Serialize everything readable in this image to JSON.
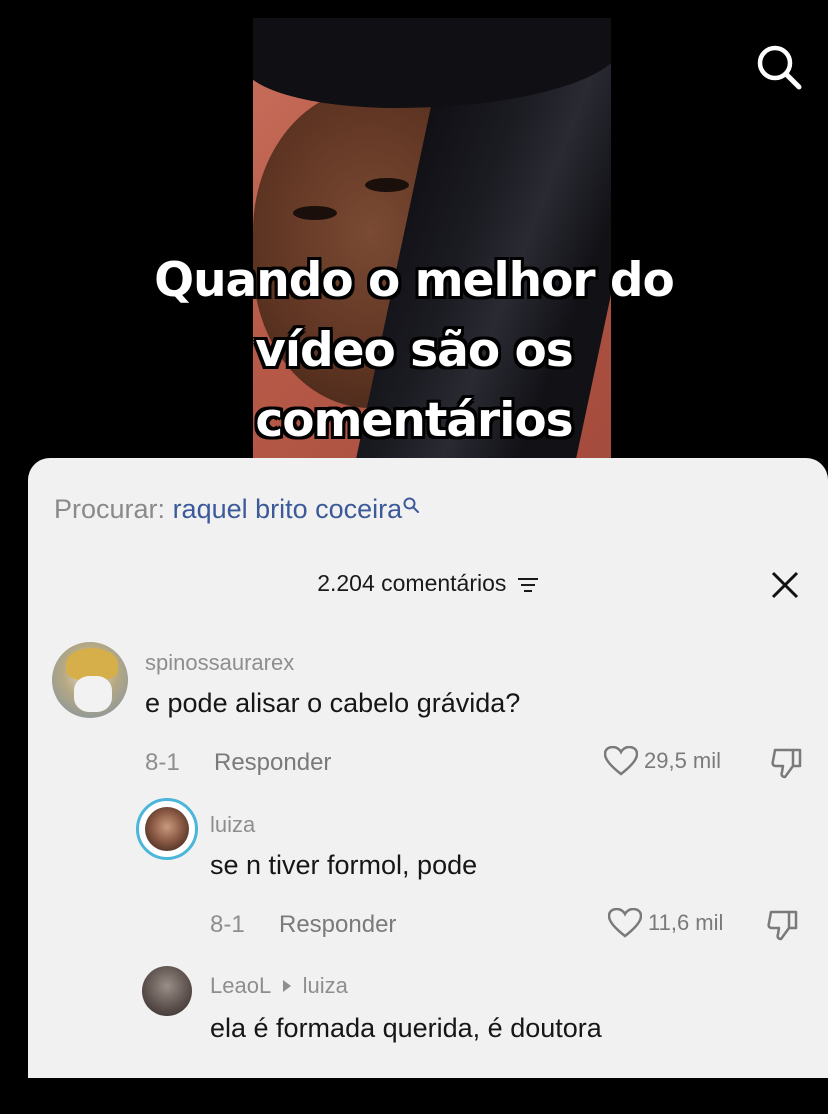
{
  "video": {
    "caption_lines": [
      "Quando o melhor do",
      "vídeo são os",
      "comentários"
    ],
    "search_icon": "search-icon"
  },
  "comments_sheet": {
    "search_prefix": "Procurar:",
    "search_term": "raquel brito coceira",
    "count_label": "2.204 comentários",
    "filter_icon": "filter-icon",
    "close_icon": "close-icon",
    "comments": [
      {
        "username": "spinossaurarex",
        "text": "e pode alisar o cabelo grávida?",
        "date": "8-1",
        "reply_label": "Responder",
        "likes": "29,5 mil"
      },
      {
        "username": "luiza",
        "text": "se n tiver formol, pode",
        "date": "8-1",
        "reply_label": "Responder",
        "likes": "11,6 mil"
      },
      {
        "username": "LeaoL",
        "reply_to": "luiza",
        "text": "ela é formada querida, é doutora"
      }
    ]
  }
}
